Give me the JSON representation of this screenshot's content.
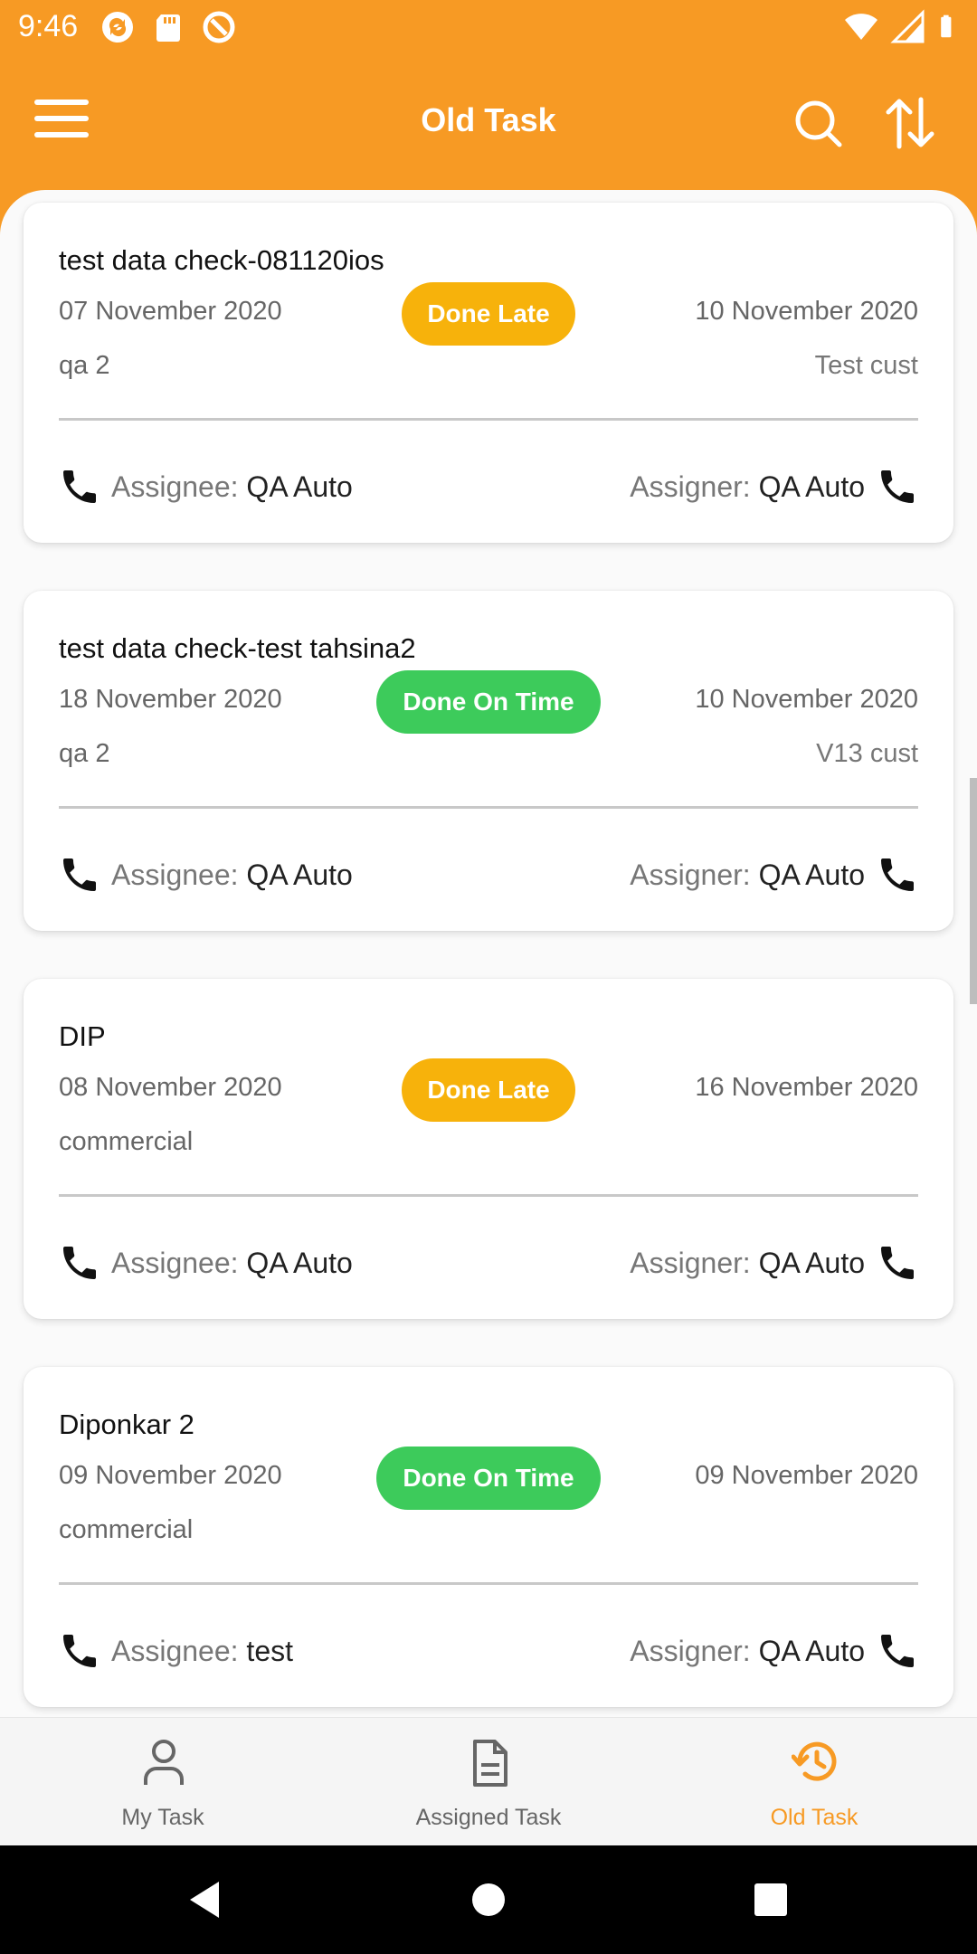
{
  "status_bar": {
    "time": "9:46",
    "left_icons": [
      "sync-icon",
      "sd-card-icon",
      "at-sign-icon"
    ],
    "right_icons": [
      "wifi-icon",
      "signal-icon",
      "battery-icon"
    ]
  },
  "app_bar": {
    "title": "Old Task",
    "icons": [
      "menu-icon",
      "search-icon",
      "sort-icon"
    ]
  },
  "tasks": [
    {
      "title": "test data check-081120ios",
      "start_date": "07 November 2020",
      "status": "Done Late",
      "end_date": "10 November 2020",
      "subtitle": "qa 2",
      "customer": "Test cust",
      "assignee_label": "Assignee:",
      "assignee": "QA Auto",
      "assigner_label": "Assigner:",
      "assigner": "QA Auto"
    },
    {
      "title": "test data check-test tahsina2",
      "start_date": "18 November 2020",
      "status": "Done On Time",
      "end_date": "10 November 2020",
      "subtitle": "qa 2",
      "customer": "V13 cust",
      "assignee_label": "Assignee:",
      "assignee": "QA Auto",
      "assigner_label": "Assigner:",
      "assigner": "QA Auto"
    },
    {
      "title": "DIP",
      "start_date": "08 November 2020",
      "status": "Done Late",
      "end_date": "16 November 2020",
      "subtitle": "commercial",
      "customer": "",
      "assignee_label": "Assignee:",
      "assignee": "QA Auto",
      "assigner_label": "Assigner:",
      "assigner": "QA Auto"
    },
    {
      "title": "Diponkar 2",
      "start_date": "09 November 2020",
      "status": "Done On Time",
      "end_date": "09 November 2020",
      "subtitle": "commercial",
      "customer": "",
      "assignee_label": "Assignee:",
      "assignee": "test",
      "assigner_label": "Assigner:",
      "assigner": "QA Auto"
    }
  ],
  "bottom_nav": {
    "items": [
      {
        "label": "My Task",
        "icon": "person-icon",
        "active": false
      },
      {
        "label": "Assigned Task",
        "icon": "document-icon",
        "active": false
      },
      {
        "label": "Old Task",
        "icon": "history-icon",
        "active": true
      }
    ]
  },
  "colors": {
    "brand": "#F79A24",
    "done_late": "#F7B20B",
    "done_on_time": "#3DCB5B"
  }
}
